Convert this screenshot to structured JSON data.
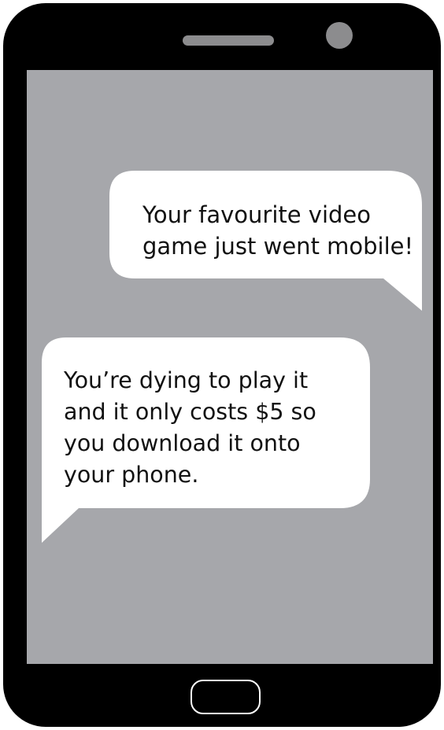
{
  "device": {
    "type": "smartphone",
    "icons": {
      "speaker": "speaker-grille-icon",
      "camera": "front-camera-icon",
      "home": "home-button-icon"
    },
    "colors": {
      "body": "#000000",
      "screen": "#a6a7ab",
      "bubble": "#ffffff",
      "detail": "#8c8c8e"
    }
  },
  "messages": [
    {
      "side": "right",
      "text": "Your favourite video\ngame just went mobile!"
    },
    {
      "side": "left",
      "text": "You’re dying to play it\nand it only costs $5 so\nyou download it onto\nyour phone."
    }
  ]
}
